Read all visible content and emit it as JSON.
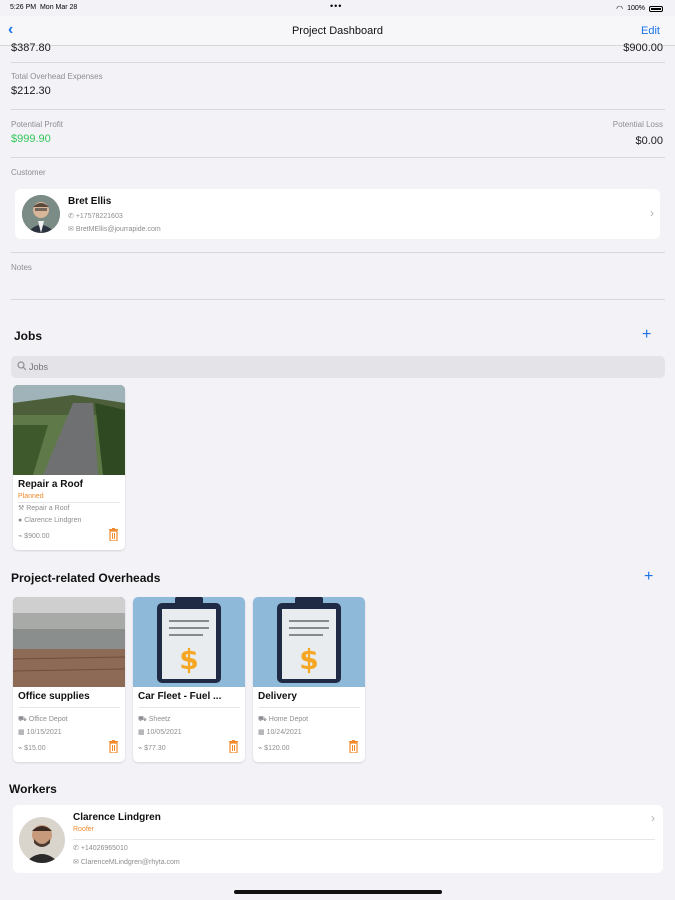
{
  "status_bar": {
    "time": "5:26 PM",
    "date": "Mon Mar 28",
    "battery": "100%"
  },
  "nav": {
    "title": "Project Dashboard",
    "edit_label": "Edit"
  },
  "financials": {
    "partial_left_value": "$387.80",
    "partial_right_value": "$900.00",
    "overhead_label": "Total Overhead Expenses",
    "overhead_value": "$212.30",
    "profit_label": "Potential Profit",
    "profit_value": "$999.90",
    "loss_label": "Potential Loss",
    "loss_value": "$0.00",
    "profit_color": "#34c759"
  },
  "customer": {
    "label": "Customer",
    "name": "Bret  Ellis",
    "phone": "+17578221603",
    "email": "BretMEllis@jourrapide.com"
  },
  "notes": {
    "label": "Notes"
  },
  "jobs": {
    "title": "Jobs",
    "search_placeholder": "Jobs",
    "items": [
      {
        "title": "Repair a Roof",
        "status": "Planned",
        "type": "Repair a Roof",
        "worker": "Clarence  Lindgren",
        "amount": "$900.00"
      }
    ]
  },
  "overheads": {
    "title": "Project-related Overheads",
    "items": [
      {
        "title": "Office supplies",
        "vendor": "Office Depot",
        "date": "10/15/2021",
        "amount": "$15.00"
      },
      {
        "title": "Car Fleet  - Fuel ...",
        "vendor": "Sheetz",
        "date": "10/05/2021",
        "amount": "$77.30"
      },
      {
        "title": "Delivery",
        "vendor": "Home Depot",
        "date": "10/24/2021",
        "amount": "$120.00"
      }
    ]
  },
  "workers": {
    "title": "Workers",
    "items": [
      {
        "name": "Clarence  Lindgren",
        "role": "Roofer",
        "phone": "+14026965010",
        "email": "ClarenceMLindgren@rhyta.com"
      }
    ]
  },
  "colors": {
    "accent": "#1a73e8",
    "status_orange": "#f08a2c",
    "clipboard_bg": "#8fb9d8"
  }
}
